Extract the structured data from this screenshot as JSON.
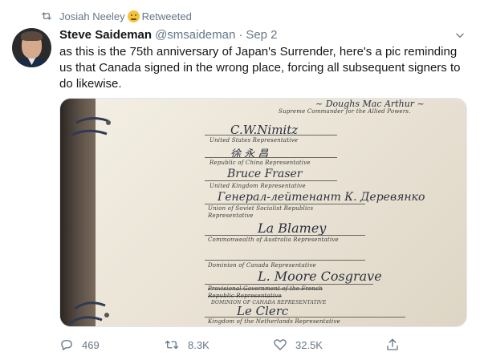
{
  "retweet": {
    "retweeter": "Josiah Neeley",
    "label": "Retweeted"
  },
  "tweet": {
    "author_name": "Steve Saideman",
    "handle": "@smsaideman",
    "separator": "·",
    "date": "Sep 2",
    "text": "as this is the 75th anniversary of Japan's Surrender, here's a pic reminding us that Canada signed in the wrong place, forcing all subsequent signers to do likewise."
  },
  "document": {
    "lines": [
      "Supreme Commander for the Allied Powers.",
      "United States Representative",
      "Republic of China Representative",
      "United Kingdom Representative",
      "Union of Soviet Socialist Republics",
      "Representative",
      "Commonwealth of Australia Representative",
      "Dominion of Canada Representative",
      "Provisional Government of the French",
      "Republic Representative",
      "Dominion of Canada Representative",
      "Kingdom of the Netherlands Representative"
    ]
  },
  "actions": {
    "replies": "469",
    "retweets": "8.3K",
    "likes": "32.5K"
  },
  "icons": {
    "retweet": "retweet-icon",
    "reply": "reply-icon",
    "like": "heart-icon",
    "share": "share-icon",
    "menu": "chevron-down-icon"
  },
  "colors": {
    "secondary_text": "#657786",
    "primary_text": "#14171a"
  }
}
